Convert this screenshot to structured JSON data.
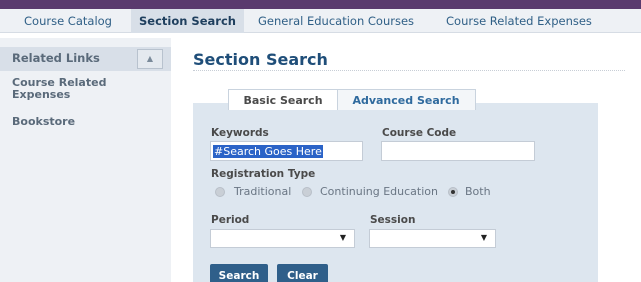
{
  "top_nav": {
    "tabs": [
      {
        "label": "Course Catalog"
      },
      {
        "label": "Section Search",
        "active": true
      },
      {
        "label": "General Education Courses"
      },
      {
        "label": "Course Related Expenses"
      }
    ]
  },
  "sidebar": {
    "title": "Related Links",
    "collapse_icon": "triangle-up-icon",
    "links": [
      {
        "line1": "Course Related",
        "line2": "Expenses"
      },
      {
        "line1": "Bookstore"
      }
    ]
  },
  "main": {
    "title": "Section Search",
    "tabs": {
      "basic": "Basic Search",
      "advanced": "Advanced Search"
    },
    "form": {
      "keywords_label": "Keywords",
      "keywords_value": "#Search Goes Here",
      "course_code_label": "Course Code",
      "course_code_value": "",
      "registration_type_label": "Registration Type",
      "registration_options": [
        "Traditional",
        "Continuing Education",
        "Both"
      ],
      "registration_selected": "Both",
      "period_label": "Period",
      "period_value": "",
      "session_label": "Session",
      "session_value": "",
      "search_button": "Search",
      "clear_button": "Clear"
    }
  },
  "colors": {
    "brand_bar": "#5a3a6e",
    "title_blue": "#1f4e79",
    "button_blue": "#2f5f8a",
    "panel_bg": "#dde6ef"
  }
}
